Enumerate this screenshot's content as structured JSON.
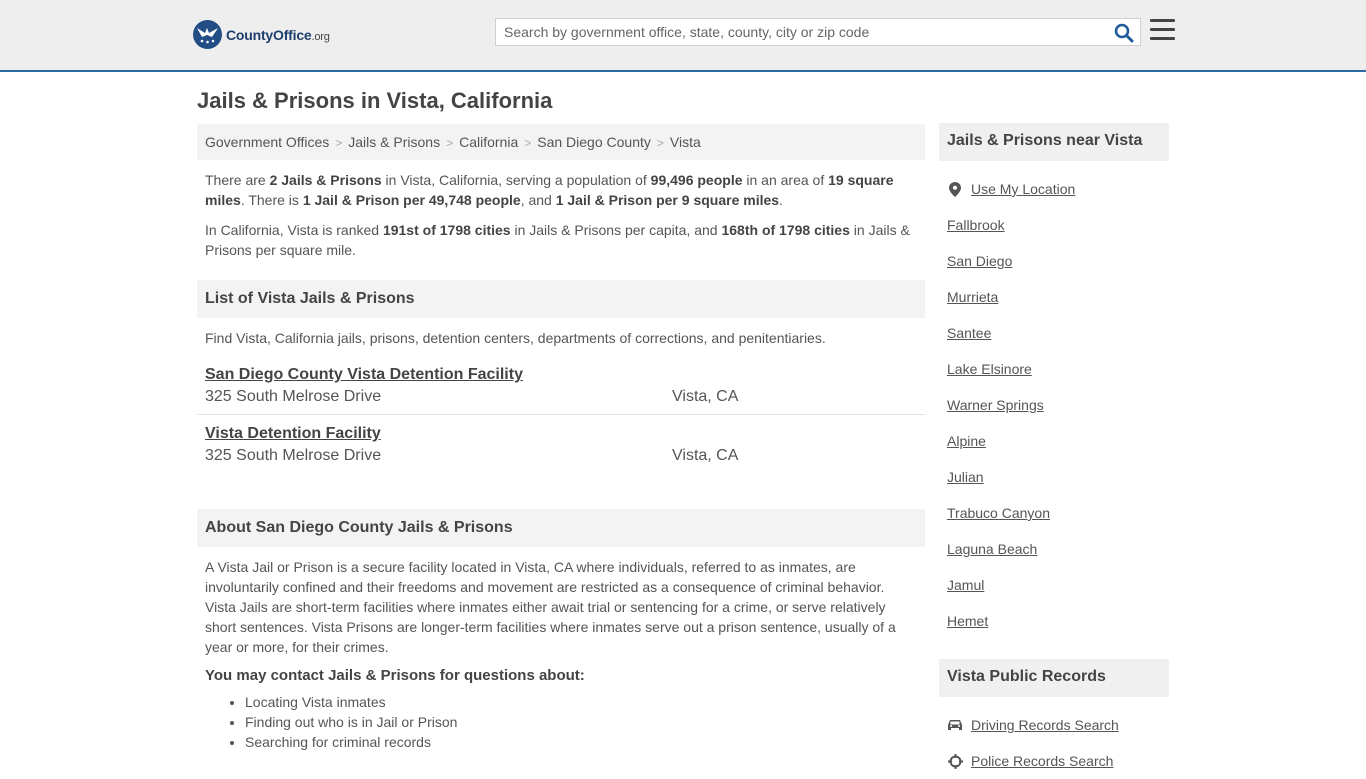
{
  "header": {
    "logo_bold": "CountyOffice",
    "logo_suffix": ".org",
    "search_placeholder": "Search by government office, state, county, city or zip code"
  },
  "page_title": "Jails & Prisons in Vista, California",
  "breadcrumb": [
    "Government Offices",
    "Jails & Prisons",
    "California",
    "San Diego County",
    "Vista"
  ],
  "breadcrumb_sep": ">",
  "summary": {
    "t1": "There are ",
    "b1": "2 Jails & Prisons",
    "t2": " in Vista, California, serving a population of ",
    "b2": "99,496 people",
    "t3": " in an area of ",
    "b3": "19 square miles",
    "t4": ". There is ",
    "b4": "1 Jail & Prison per 49,748 people",
    "t5": ", and ",
    "b5": "1 Jail & Prison per 9 square miles",
    "t6": "."
  },
  "ranking": {
    "t1": "In California, Vista is ranked ",
    "b1": "191st of 1798 cities",
    "t2": " in Jails & Prisons per capita, and ",
    "b2": "168th of 1798 cities",
    "t3": " in Jails & Prisons per square mile."
  },
  "list": {
    "heading": "List of Vista Jails & Prisons",
    "intro": "Find Vista, California jails, prisons, detention centers, departments of corrections, and penitentiaries.",
    "facilities": [
      {
        "name": "San Diego County Vista Detention Facility",
        "address": "325 South Melrose Drive",
        "city": "Vista, CA"
      },
      {
        "name": "Vista Detention Facility",
        "address": "325 South Melrose Drive",
        "city": "Vista, CA"
      }
    ]
  },
  "about": {
    "heading": "About San Diego County Jails & Prisons",
    "text": "A Vista Jail or Prison is a secure facility located in Vista, CA where individuals, referred to as inmates, are involuntarily confined and their freedoms and movement are restricted as a consequence of criminal behavior. Vista Jails are short-term facilities where inmates either await trial or sentencing for a crime, or serve relatively short sentences. Vista Prisons are longer-term facilities where inmates serve out a prison sentence, usually of a year or more, for their crimes.",
    "contact_heading": "You may contact Jails & Prisons for questions about:",
    "bullets": [
      "Locating Vista inmates",
      "Finding out who is in Jail or Prison",
      "Searching for criminal records"
    ]
  },
  "sidebar": {
    "near_heading": "Jails & Prisons near Vista",
    "use_location": "Use My Location",
    "nearby": [
      "Fallbrook",
      "San Diego",
      "Murrieta",
      "Santee",
      "Lake Elsinore",
      "Warner Springs",
      "Alpine",
      "Julian",
      "Trabuco Canyon",
      "Laguna Beach",
      "Jamul",
      "Hemet"
    ],
    "records_heading": "Vista Public Records",
    "records": [
      {
        "label": "Driving Records Search",
        "icon": "car-icon"
      },
      {
        "label": "Police Records Search",
        "icon": "crosshair-icon"
      }
    ]
  },
  "colors": {
    "header_bg": "#eeeeee",
    "header_border": "#2d6aa3",
    "search_icon": "#1f5b9b",
    "logo_blue": "#234e85"
  }
}
